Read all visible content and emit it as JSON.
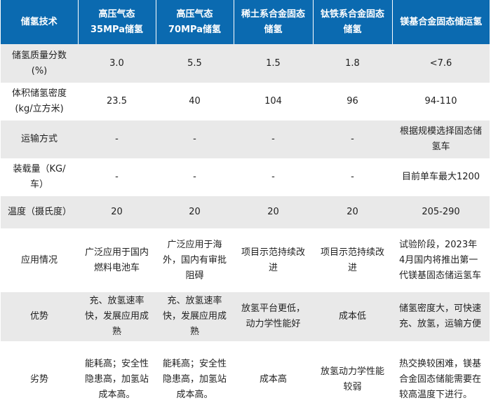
{
  "header": [
    "储氢技术",
    "高压气态35MPa储氢",
    "高压气态70MPa储氢",
    "稀土系合金固态储氢",
    "钛铁系合金固态储氢",
    "镁基合金固态储运氢"
  ],
  "rows": [
    {
      "label": "储氢质量分数(%)",
      "cells": [
        "3.0",
        "5.5",
        "1.5",
        "1.8",
        "<7.6"
      ]
    },
    {
      "label": "体积储氢密度(kg/立方米)",
      "cells": [
        "23.5",
        "40",
        "104",
        "96",
        "94-110"
      ]
    },
    {
      "label": "运输方式",
      "cells": [
        "-",
        "-",
        "-",
        "-",
        "根据规模选择固态储氢车"
      ]
    },
    {
      "label": "装载量（KG/车）",
      "cells": [
        "-",
        "-",
        "-",
        "-",
        "目前单车最大1200"
      ]
    },
    {
      "label": "温度（摄氏度）",
      "cells": [
        "20",
        "20",
        "20",
        "20",
        "205-290"
      ]
    },
    {
      "label": "应用情况",
      "cells": [
        "广泛应用于国内燃料电池车",
        "广泛应用于海外，国内有审批阻碍",
        "项目示范持续改进",
        "项目示范持续改进",
        "试验阶段，2023年4月国内将推出第一代镁基固态储运氢车"
      ]
    },
    {
      "label": "优势",
      "cells": [
        "充、放氢速率快，发展应用成熟",
        "充、放氢速率快，发展应用成熟",
        "放氢平台更低，动力学性能好",
        "成本低",
        "储氢密度大，可快速充、放氢，运输方便"
      ]
    },
    {
      "label": "劣势",
      "cells": [
        "能耗高；安全性隐患高，加氢站成本高。",
        "能耗高；安全性隐患高，加氢站成本高。",
        "成本高",
        "放氢动力学性能较弱",
        "热交换较困难，镁基合金固态储能需要在较高温度下进行。"
      ]
    }
  ]
}
